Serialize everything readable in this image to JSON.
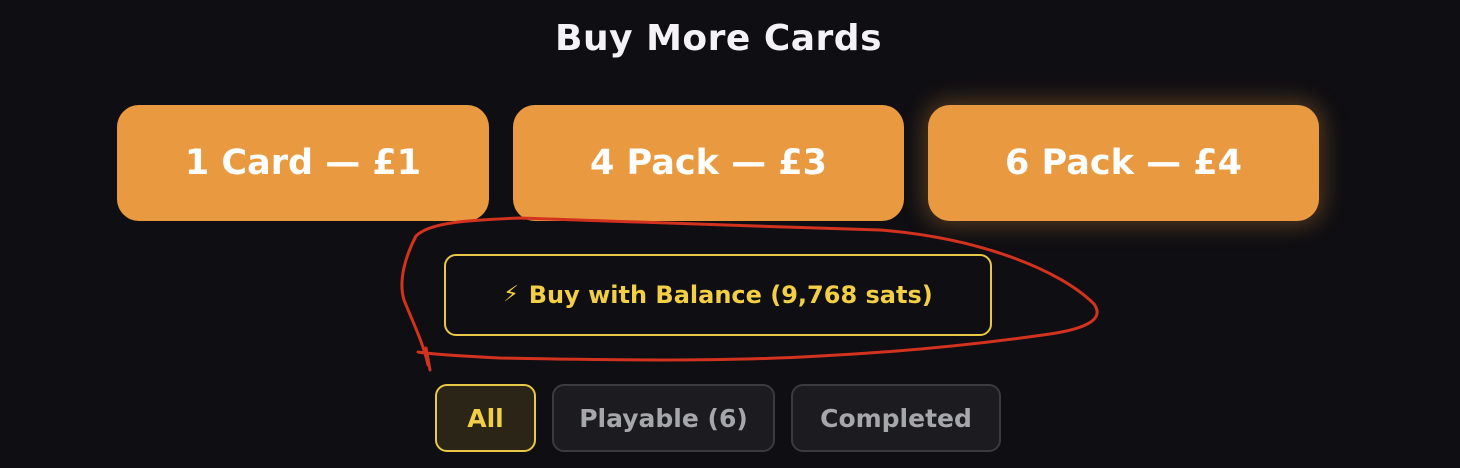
{
  "section": {
    "title": "Buy More Cards"
  },
  "packs": [
    {
      "label": "1 Card — £1"
    },
    {
      "label": "4 Pack — £3"
    },
    {
      "label": "6 Pack — £4"
    }
  ],
  "balance_button": {
    "icon": "lightning-bolt-icon",
    "icon_glyph": "⚡",
    "label": "Buy with Balance (9,768 sats)"
  },
  "filters": [
    {
      "label": "All",
      "selected": true
    },
    {
      "label": "Playable (6)",
      "selected": false
    },
    {
      "label": "Completed",
      "selected": false
    }
  ],
  "colors": {
    "background": "#0f0e12",
    "pack_button": "#e99a40",
    "accent_yellow": "#f2cf44",
    "annotation_red": "#d2321e"
  }
}
